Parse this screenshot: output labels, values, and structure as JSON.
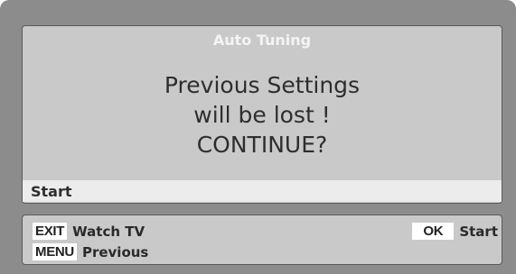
{
  "dialog": {
    "title": "Auto Tuning",
    "message_lines": [
      "Previous Settings",
      "will be lost !",
      "CONTINUE?"
    ],
    "selected_item": "Start"
  },
  "footer": {
    "exit": {
      "key": "EXIT",
      "label": "Watch TV"
    },
    "menu": {
      "key": "MENU",
      "label": "Previous"
    },
    "ok": {
      "key": "OK",
      "label": "Start"
    }
  },
  "colors": {
    "screen_background": "#8c8c8c",
    "panel": "#c9c9c9",
    "selection_bar": "#ececec",
    "title_text": "#f4f4f4",
    "key_badge": "#ffffff"
  }
}
